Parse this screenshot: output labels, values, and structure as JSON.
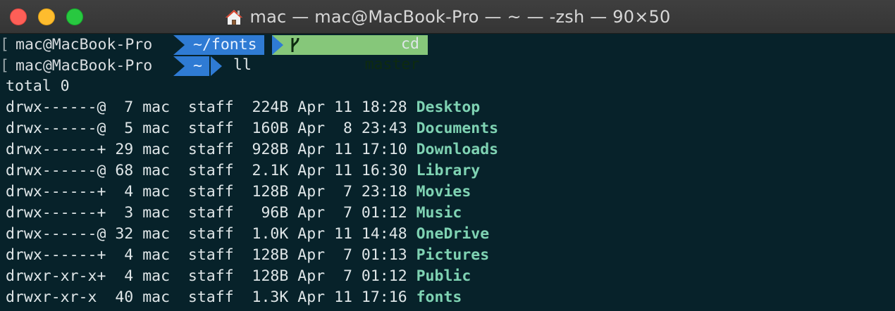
{
  "window": {
    "title": "mac — mac@MacBook-Pro — ~ — -zsh — 90×50"
  },
  "prompts": [
    {
      "bracket": "[",
      "user": "mac@MacBook-Pro",
      "dir": "~/fonts",
      "git": "master",
      "command": "cd"
    },
    {
      "bracket": "[",
      "user": "mac@MacBook-Pro",
      "dir": "~",
      "command": "ll"
    }
  ],
  "total_line": "total 0",
  "listing": [
    {
      "perm": "drwx------@",
      "n": " 7",
      "user": "mac",
      "group": "staff",
      "size": "224B",
      "month": "Apr",
      "day": "11",
      "time": "18:28",
      "name": "Desktop"
    },
    {
      "perm": "drwx------@",
      "n": " 5",
      "user": "mac",
      "group": "staff",
      "size": "160B",
      "month": "Apr",
      "day": " 8",
      "time": "23:43",
      "name": "Documents"
    },
    {
      "perm": "drwx------+",
      "n": "29",
      "user": "mac",
      "group": "staff",
      "size": "928B",
      "month": "Apr",
      "day": "11",
      "time": "17:10",
      "name": "Downloads"
    },
    {
      "perm": "drwx------@",
      "n": "68",
      "user": "mac",
      "group": "staff",
      "size": "2.1K",
      "month": "Apr",
      "day": "11",
      "time": "16:30",
      "name": "Library"
    },
    {
      "perm": "drwx------+",
      "n": " 4",
      "user": "mac",
      "group": "staff",
      "size": "128B",
      "month": "Apr",
      "day": " 7",
      "time": "23:18",
      "name": "Movies"
    },
    {
      "perm": "drwx------+",
      "n": " 3",
      "user": "mac",
      "group": "staff",
      "size": " 96B",
      "month": "Apr",
      "day": " 7",
      "time": "01:12",
      "name": "Music"
    },
    {
      "perm": "drwx------@",
      "n": "32",
      "user": "mac",
      "group": "staff",
      "size": "1.0K",
      "month": "Apr",
      "day": "11",
      "time": "14:48",
      "name": "OneDrive"
    },
    {
      "perm": "drwx------+",
      "n": " 4",
      "user": "mac",
      "group": "staff",
      "size": "128B",
      "month": "Apr",
      "day": " 7",
      "time": "01:13",
      "name": "Pictures"
    },
    {
      "perm": "drwxr-xr-x+",
      "n": " 4",
      "user": "mac",
      "group": "staff",
      "size": "128B",
      "month": "Apr",
      "day": " 7",
      "time": "01:12",
      "name": "Public"
    },
    {
      "perm": "drwxr-xr-x ",
      "n": "40",
      "user": "mac",
      "group": "staff",
      "size": "1.3K",
      "month": "Apr",
      "day": "11",
      "time": "17:16",
      "name": "fonts"
    }
  ],
  "colors": {
    "dir_segment": "#2f7bd4",
    "git_segment": "#86c77a",
    "directory_name": "#7fd3b3",
    "background": "#07222a"
  },
  "icons": {
    "title": "home-icon",
    "git": "git-branch-icon"
  }
}
